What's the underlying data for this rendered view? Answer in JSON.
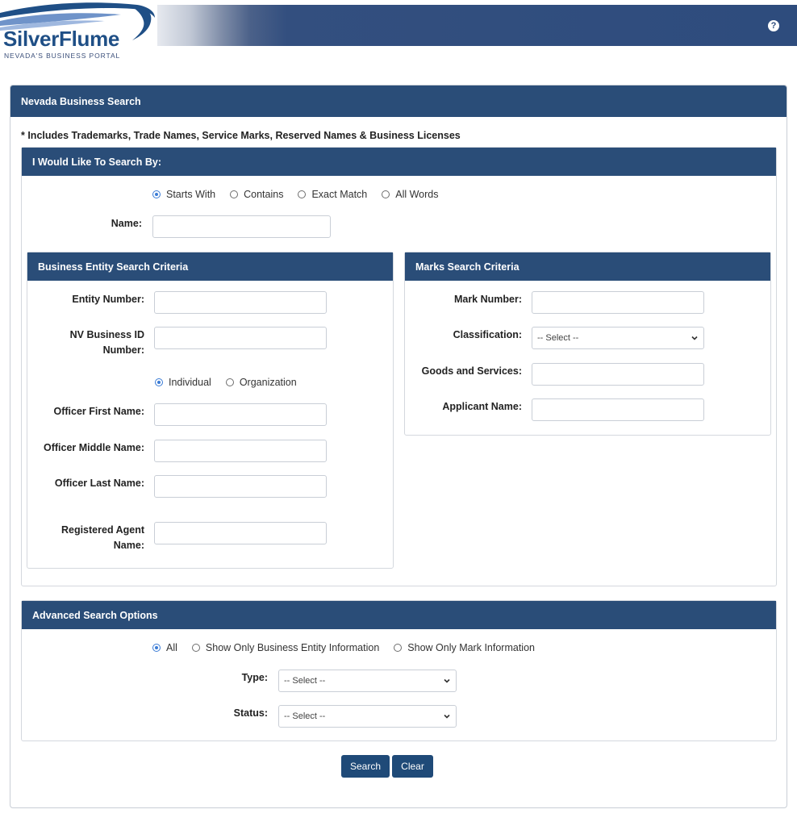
{
  "header": {
    "logo_text": "SilverFlume",
    "logo_subtitle": "NEVADA'S BUSINESS PORTAL",
    "help_icon": "question-circle-icon",
    "help_glyph": "?"
  },
  "page": {
    "title": "Nevada Business Search",
    "note": "* Includes Trademarks, Trade Names, Service Marks, Reserved Names & Business Licenses"
  },
  "search_by": {
    "title": "I Would Like To Search By:",
    "options": [
      "Starts With",
      "Contains",
      "Exact Match",
      "All Words"
    ],
    "selected": "Starts With",
    "name_label": "Name:",
    "name_value": ""
  },
  "entity": {
    "title": "Business Entity Search Criteria",
    "entity_number_label": "Entity Number:",
    "nv_id_label_1": "NV Business ID",
    "nv_id_label_2": "Number:",
    "officer_type_options": [
      "Individual",
      "Organization"
    ],
    "officer_type_selected": "Individual",
    "officer_first_label": "Officer First Name:",
    "officer_middle_label": "Officer Middle Name:",
    "officer_last_label": "Officer Last Name:",
    "agent_label_1": "Registered Agent",
    "agent_label_2": "Name:"
  },
  "marks": {
    "title": "Marks Search Criteria",
    "mark_number_label": "Mark Number:",
    "classification_label": "Classification:",
    "classification_value": "-- Select --",
    "goods_label": "Goods and Services:",
    "applicant_label": "Applicant Name:"
  },
  "advanced": {
    "title": "Advanced Search Options",
    "options": [
      "All",
      "Show Only Business Entity Information",
      "Show Only Mark Information"
    ],
    "selected": "All",
    "type_label": "Type:",
    "type_value": "-- Select --",
    "status_label": "Status:",
    "status_value": "-- Select --"
  },
  "buttons": {
    "search": "Search",
    "clear": "Clear"
  },
  "colors": {
    "header_blue": "#2e4c7d",
    "panel_head": "#2a4d78",
    "button": "#1f4a78",
    "radio_selected": "#3a7bd5"
  }
}
